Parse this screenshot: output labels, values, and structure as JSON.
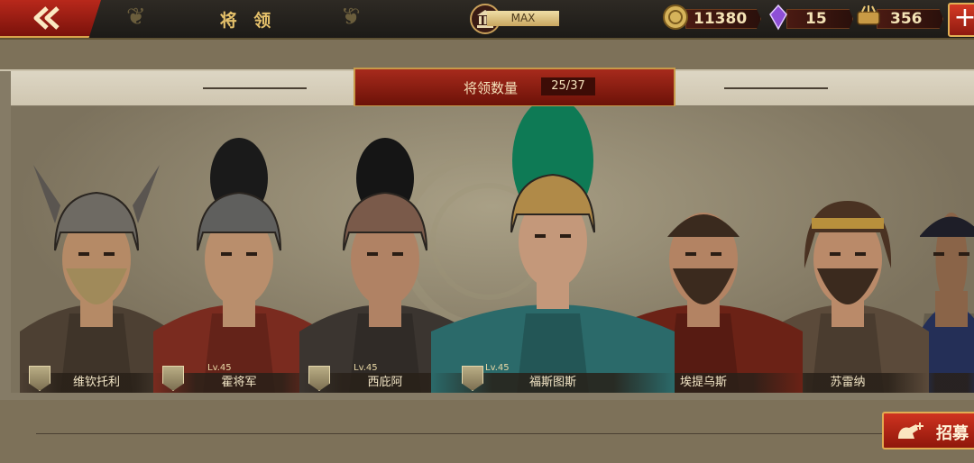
{
  "header": {
    "title": "将 领",
    "building_level": "MAX",
    "resources": {
      "coins": "11380",
      "gems": "15",
      "food": "356"
    }
  },
  "roster_header": {
    "label": "将领数量",
    "count": "25/37"
  },
  "generals": [
    {
      "name": "维钦托利",
      "level": "",
      "helmet": "#6e6a63",
      "plume": "",
      "armor": "#4d4033"
    },
    {
      "name": "霍将军",
      "level": "Lv.45",
      "helmet": "#5f5f5d",
      "plume": "#1a1a1a",
      "armor": "#7a2b1f"
    },
    {
      "name": "西庇阿",
      "level": "Lv.45",
      "helmet": "#7a5a4a",
      "plume": "#151515",
      "armor": "#3b3530"
    },
    {
      "name": "福斯图斯",
      "level": "Lv.45",
      "helmet": "#b08a48",
      "plume": "#0e7a55",
      "armor": "#2b6a6a"
    },
    {
      "name": "埃提乌斯",
      "level": "",
      "helmet": "",
      "plume": "",
      "armor": "#6b2216"
    },
    {
      "name": "苏雷纳",
      "level": "",
      "helmet": "",
      "plume": "",
      "armor": "#5b4a3a"
    },
    {
      "name": "",
      "level": "",
      "helmet": "",
      "plume": "",
      "armor": "#2c3a6b"
    }
  ],
  "recruit_button": {
    "label": "招募"
  },
  "colors": {
    "accent_red": "#a72a1c",
    "gold": "#e4c06a"
  }
}
